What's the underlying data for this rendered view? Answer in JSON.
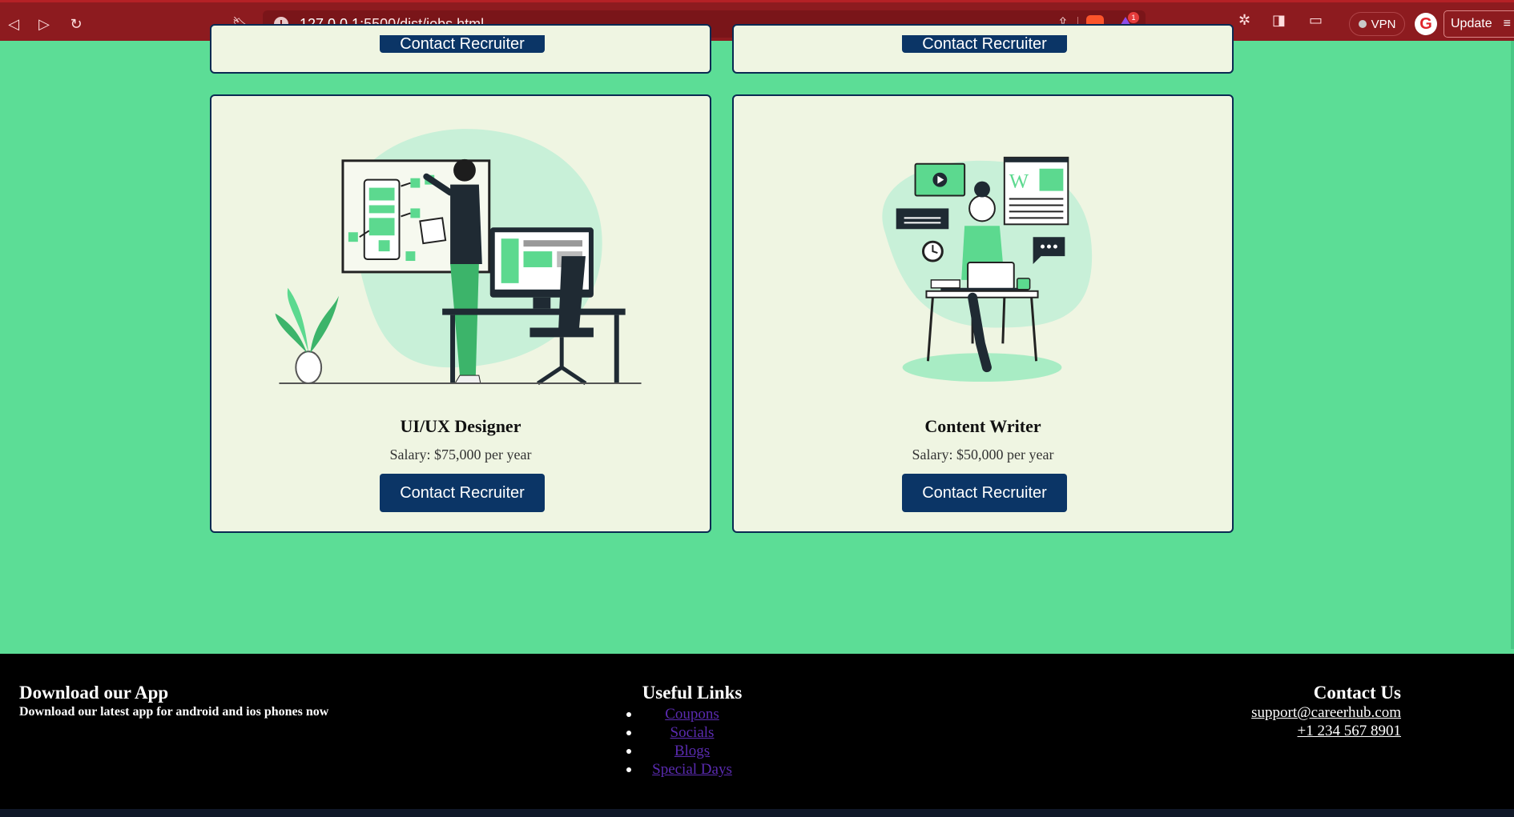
{
  "browser": {
    "url_host": "127.0.0.1",
    "url_rest": ":5500/dist/jobs.html",
    "vpn_label": "VPN",
    "update_label": "Update",
    "bat_badge": "1",
    "accent_color": "#8d1b1f"
  },
  "cards_top": [
    {
      "button": "Contact Recruiter"
    },
    {
      "button": "Contact Recruiter"
    }
  ],
  "cards": [
    {
      "title": "UI/UX Designer",
      "salary": "Salary: $75,000 per year",
      "button": "Contact Recruiter",
      "illustration": "designer-at-board-icon"
    },
    {
      "title": "Content Writer",
      "salary": "Salary: $50,000 per year",
      "button": "Contact Recruiter",
      "illustration": "writer-at-desk-icon"
    }
  ],
  "footer": {
    "app_title": "Download our App",
    "app_text": "Download our latest app for android and ios phones now",
    "links_title": "Useful Links",
    "links": [
      "Coupons",
      "Socials",
      "Blogs",
      "Special Days"
    ],
    "contact_title": "Contact Us",
    "email": "support@careerhub.com",
    "phone": "+1 234 567 8901"
  },
  "colors": {
    "page_bg": "#5cdd96",
    "card_bg": "#eff5e2",
    "button_bg": "#0b3566",
    "footer_bg": "#000000"
  }
}
